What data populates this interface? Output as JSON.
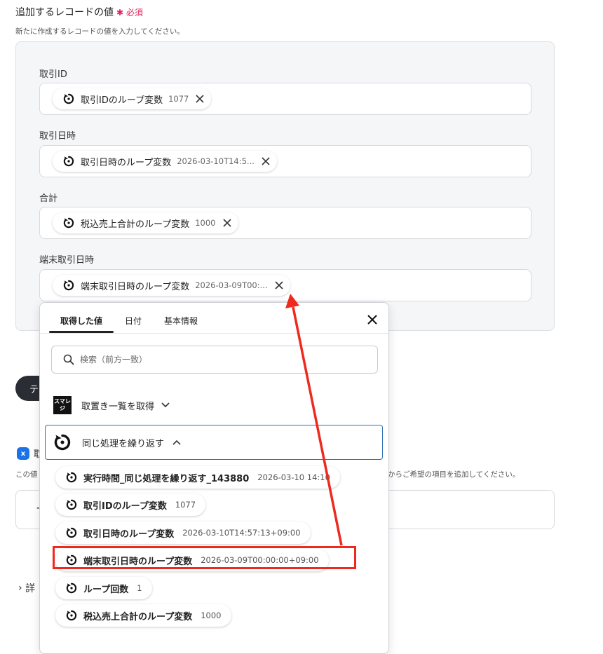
{
  "header": {
    "title": "追加するレコードの値",
    "required_mark": "✱",
    "required_label": "必須",
    "subtitle": "新たに作成するレコードの値を入力してください。"
  },
  "fields": [
    {
      "label": "取引ID",
      "chip_text": "取引IDのループ変数",
      "chip_value": "1077"
    },
    {
      "label": "取引日時",
      "chip_text": "取引日時のループ変数",
      "chip_value": "2026-03-10T14:5..."
    },
    {
      "label": "合計",
      "chip_text": "税込売上合計のループ変数",
      "chip_value": "1000"
    },
    {
      "label": "端末取引日時",
      "chip_text": "端末取引日時のループ変数",
      "chip_value": "2026-03-09T00:..."
    }
  ],
  "background": {
    "badge_letter": "x",
    "partial_heading": "取",
    "text_left": "この値",
    "text_right": "からご希望の項目を追加してください。",
    "box_text": "+",
    "details_label": "詳",
    "button_text": "テ"
  },
  "popup": {
    "tabs": [
      "取得した値",
      "日付",
      "基本情報"
    ],
    "active_tab": 0,
    "search_placeholder": "検索（前方一致）",
    "groups": [
      {
        "label": "取置き一覧を取得",
        "logo_text": "スマレジ",
        "expanded": false
      },
      {
        "label": "同じ処理を繰り返す",
        "expanded": true
      }
    ],
    "items": [
      {
        "text": "実行時間_同じ処理を繰り返す_143880",
        "value": "2026-03-10 14:10"
      },
      {
        "text": "取引IDのループ変数",
        "value": "1077"
      },
      {
        "text": "取引日時のループ変数",
        "value": "2026-03-10T14:57:13+09:00"
      },
      {
        "text": "端末取引日時のループ変数",
        "value": "2026-03-09T00:00:00+09:00"
      },
      {
        "text": "ループ回数",
        "value": "1"
      },
      {
        "text": "税込売上合計のループ変数",
        "value": "1000"
      }
    ]
  },
  "colors": {
    "accent_red": "#ee2a1e",
    "required_pink": "#e0245e",
    "focus_blue": "#2f6fb5"
  }
}
